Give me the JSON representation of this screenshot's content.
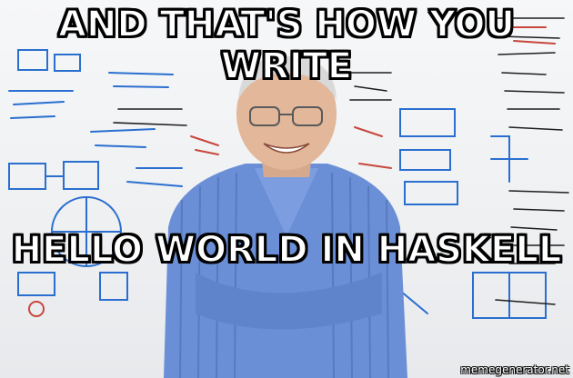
{
  "meme": {
    "top_text": "AND THAT'S HOW YOU WRITE",
    "bottom_text": "HELLO WORLD IN HASKELL",
    "watermark": "memegenerator.net"
  },
  "scene": {
    "background": "whiteboard-with-diagrams",
    "subject": "smiling-professor-blue-striped-shirt",
    "colors": {
      "board": "#f2f3f5",
      "marker_blue": "#2a6fd0",
      "marker_red": "#c8473c",
      "marker_black": "#1e1e1e",
      "shirt": "#6b8fd6",
      "skin": "#e2b79a",
      "hair": "#d9d9d9"
    }
  }
}
